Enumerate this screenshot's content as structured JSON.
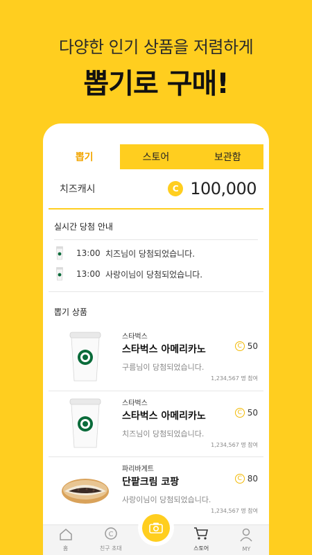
{
  "headline": {
    "subtitle": "다양한 인기 상품을 저렴하게",
    "title": "뽑기로 구매!"
  },
  "tabs": [
    {
      "label": "뽑기",
      "active": true
    },
    {
      "label": "스토어",
      "active": false
    },
    {
      "label": "보관함",
      "active": false
    }
  ],
  "cash": {
    "label": "치즈캐시",
    "coin_symbol": "C",
    "value": "100,000"
  },
  "live": {
    "title": "실시간 당첨 안내",
    "rows": [
      {
        "time": "13:00",
        "text": "치즈님이 당첨되었습니다."
      },
      {
        "time": "13:00",
        "text": "사랑이님이 당첨되었습니다."
      }
    ]
  },
  "goods": {
    "title": "뽑기 상품",
    "items": [
      {
        "brand": "스타벅스",
        "name": "스타벅스 아메리카노",
        "winner": "구름님이 당첨되었습니다.",
        "price": "50",
        "participants": "1,234,567 명 참여",
        "image": "coffee-cup"
      },
      {
        "brand": "스타벅스",
        "name": "스타벅스 아메리카노",
        "winner": "치즈님이 당첨되었습니다.",
        "price": "50",
        "participants": "1,234,567 명 참여",
        "image": "coffee-cup"
      },
      {
        "brand": "파리바게트",
        "name": "단팥크림 코팡",
        "winner": "사랑이님이 당첨되었습니다.",
        "price": "80",
        "participants": "1,234,567 명 참여",
        "image": "bread"
      }
    ]
  },
  "nav": {
    "home": "홈",
    "invite": "친구 초대",
    "camera_icon": "camera-icon",
    "store": "스토어",
    "my": "MY"
  },
  "colors": {
    "brand_yellow": "#FFCE1F",
    "accent_orange": "#F2A500"
  }
}
